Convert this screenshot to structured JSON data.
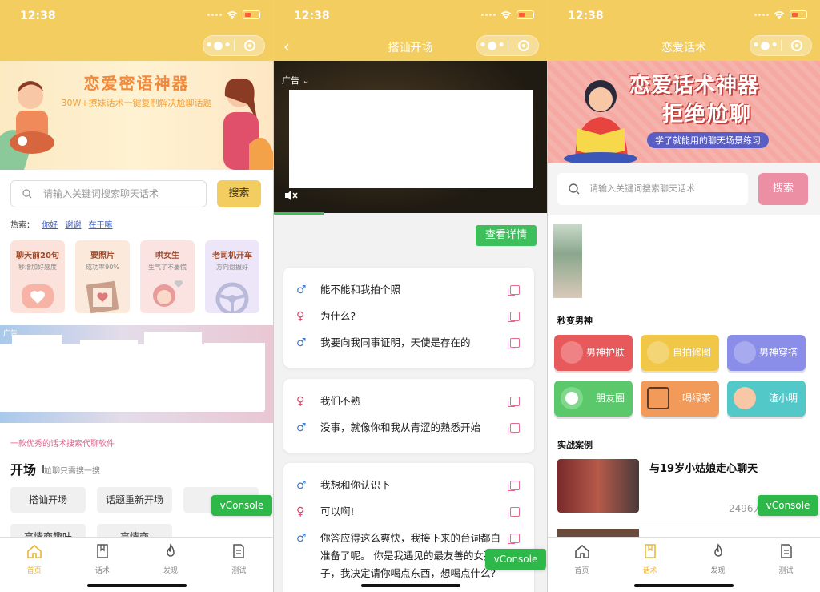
{
  "status": {
    "time": "12:38"
  },
  "phone1": {
    "banner": {
      "title": "恋爱密语神器",
      "subtitle": "30W+撩妹话术一键复制解决尬聊话题"
    },
    "search": {
      "placeholder": "请输入关键词搜索聊天话术",
      "button": "搜索"
    },
    "hot": {
      "label": "热索：",
      "items": [
        "你好",
        "谢谢",
        "在干嘛"
      ]
    },
    "cards": [
      {
        "title": "聊天前20句",
        "sub": "秒增加好感度",
        "bg": "#fbe3dc"
      },
      {
        "title": "要照片",
        "sub": "成功率90%",
        "bg": "#fbe9dc"
      },
      {
        "title": "哄女生",
        "sub": "生气了不要慌",
        "bg": "#fbe3e2"
      },
      {
        "title": "老司机开车",
        "sub": "方向盘握好",
        "bg": "#ece6f8"
      }
    ],
    "ad_label": "广告",
    "tagline": "一款优秀的话术搜索代聊软件",
    "section": {
      "title": "开场",
      "sub": "尬聊只需搜一搜"
    },
    "pills": [
      "搭讪开场",
      "话题重新开场",
      "高情商趣味",
      "高情商"
    ],
    "vconsole": "vConsole"
  },
  "phone2": {
    "nav_title": "搭讪开场",
    "video_ad_label": "广告",
    "detail_button": "查看详情",
    "groups": [
      {
        "lines": [
          {
            "g": "male",
            "text": "能不能和我拍个照"
          },
          {
            "g": "female",
            "text": "为什么?"
          },
          {
            "g": "male",
            "text": "我要向我同事证明，天使是存在的"
          }
        ]
      },
      {
        "lines": [
          {
            "g": "female",
            "text": "我们不熟"
          },
          {
            "g": "male",
            "text": "没事，就像你和我从青涩的熟悉开始"
          }
        ]
      },
      {
        "lines": [
          {
            "g": "male",
            "text": "我想和你认识下"
          },
          {
            "g": "female",
            "text": "可以啊!"
          },
          {
            "g": "male",
            "text": "你答应得这么爽快，我接下来的台词都白准备了呢。 你是我遇见的最友善的女孩子，我决定请你喝点东西，想喝点什么?"
          }
        ]
      }
    ],
    "vconsole": "vConsole"
  },
  "phone3": {
    "nav_title": "恋爱话术",
    "banner": {
      "line1": "恋爱话术神器",
      "line2": "拒绝尬聊",
      "sub": "学了就能用的聊天场景练习"
    },
    "search": {
      "placeholder": "请输入关键词搜索聊天话术",
      "button": "搜索"
    },
    "sec1": "秒变男神",
    "tiles": [
      {
        "label": "男神护肤",
        "color": "#e8595c"
      },
      {
        "label": "自拍修图",
        "color": "#f1c748"
      },
      {
        "label": "男神穿搭",
        "color": "#8a8ee8"
      },
      {
        "label": "朋友圈",
        "color": "#5cc86c"
      },
      {
        "label": "喝绿茶",
        "color": "#f29a59"
      },
      {
        "label": "渣小明",
        "color": "#52c8c8"
      }
    ],
    "sec2": "实战案例",
    "case": {
      "title": "与19岁小姑娘走心聊天",
      "count": "2496人"
    },
    "vconsole": "vConsole"
  },
  "tabs": [
    "首页",
    "话术",
    "发现",
    "测试"
  ]
}
